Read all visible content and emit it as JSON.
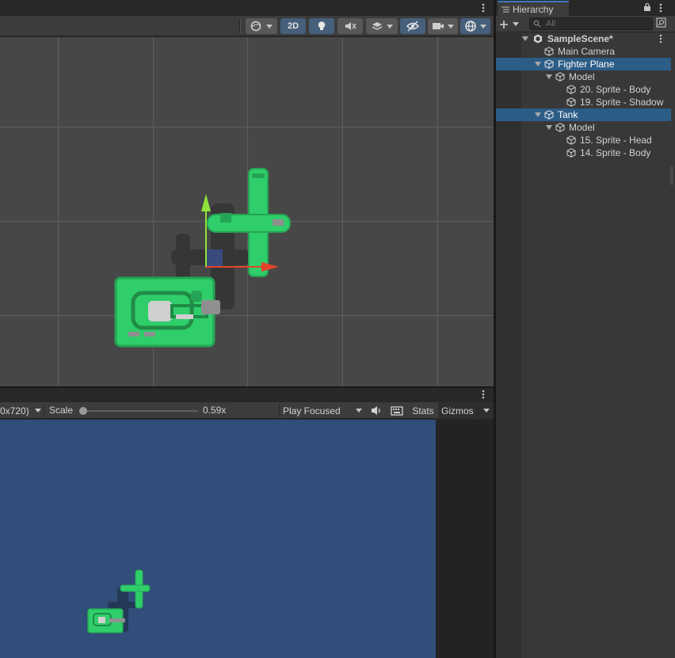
{
  "scene_toolbar": {
    "mode_2d_label": "2D"
  },
  "game_toolbar": {
    "resolution_label": "0x720)",
    "scale_label": "Scale",
    "scale_value": "0.59x",
    "scale_fraction": 0.0,
    "play_mode_label": "Play Focused",
    "stats_label": "Stats",
    "gizmos_label": "Gizmos"
  },
  "hierarchy": {
    "tab_label": "Hierarchy",
    "search_placeholder": "All",
    "items": [
      {
        "label": "SampleScene*"
      },
      {
        "label": "Main Camera"
      },
      {
        "label": "Fighter Plane"
      },
      {
        "label": "Model"
      },
      {
        "label": "20. Sprite - Body"
      },
      {
        "label": "19. Sprite - Shadow"
      },
      {
        "label": "Tank"
      },
      {
        "label": "Model"
      },
      {
        "label": "15. Sprite - Head"
      },
      {
        "label": "14. Sprite - Body"
      }
    ]
  },
  "colors": {
    "scene_bg": "#474747",
    "game_bg": "#314d79",
    "selection": "#2c5d87",
    "sprite_green": "#2fce6a",
    "gizmo_y": "#8fe33a",
    "gizmo_x": "#e5432c"
  }
}
